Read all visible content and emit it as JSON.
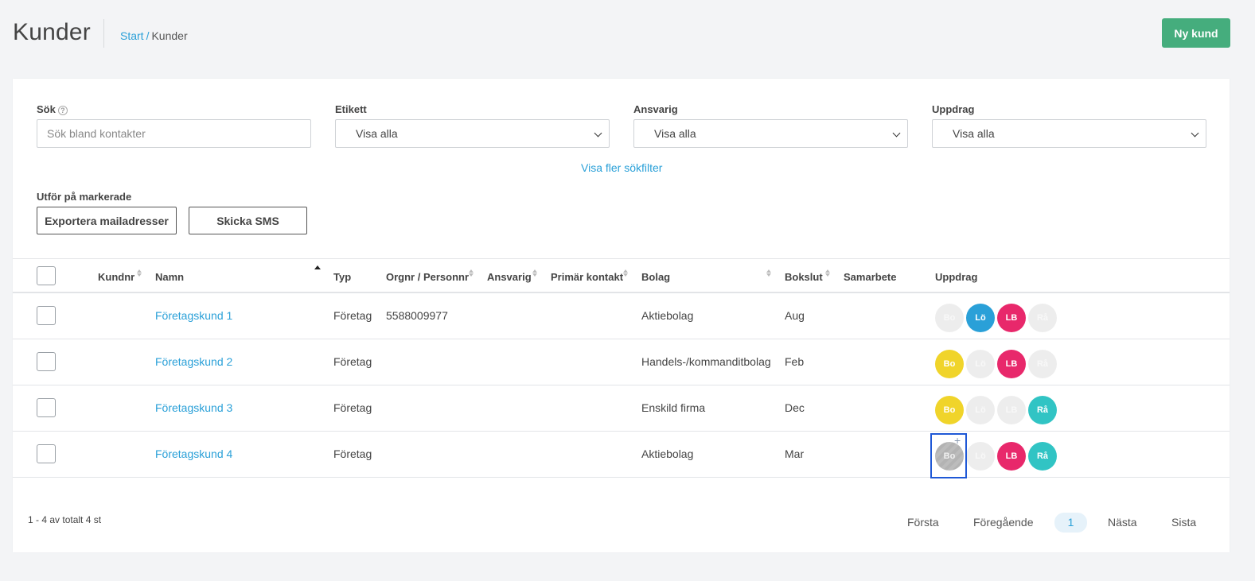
{
  "header": {
    "title": "Kunder",
    "breadcrumb": {
      "start": "Start",
      "separator": "/",
      "current": "Kunder"
    },
    "new_button": "Ny kund"
  },
  "filters": {
    "search": {
      "label": "Sök",
      "help": "?",
      "placeholder": "Sök bland kontakter",
      "value": ""
    },
    "etikett": {
      "label": "Etikett",
      "value": "Visa alla"
    },
    "ansvarig": {
      "label": "Ansvarig",
      "value": "Visa alla"
    },
    "uppdrag": {
      "label": "Uppdrag",
      "value": "Visa alla"
    },
    "more": "Visa fler sökfilter"
  },
  "bulk": {
    "label": "Utför på markerade",
    "export": "Exportera mailadresser",
    "sms": "Skicka SMS"
  },
  "table": {
    "columns": {
      "kundnr": "Kundnr",
      "namn": "Namn",
      "typ": "Typ",
      "orgnr": "Orgnr / Personnr",
      "ansvarig": "Ansvarig",
      "primar": "Primär kontakt",
      "bolag": "Bolag",
      "bokslut": "Bokslut",
      "samarbete": "Samarbete",
      "uppdrag": "Uppdrag"
    },
    "sorted_column": "Namn",
    "sort_direction": "ascending",
    "rows": [
      {
        "kundnr": "",
        "namn": "Företagskund 1",
        "typ": "Företag",
        "orgnr": "5588009977",
        "ansvarig": "",
        "primar": "",
        "bolag": "Aktiebolag",
        "bokslut": "Aug",
        "samarbete": "",
        "uppdrag": [
          {
            "label": "Bo",
            "state": "inactive"
          },
          {
            "label": "Lö",
            "state": "active"
          },
          {
            "label": "LB",
            "state": "active"
          },
          {
            "label": "Rå",
            "state": "inactive"
          }
        ]
      },
      {
        "kundnr": "",
        "namn": "Företagskund 2",
        "typ": "Företag",
        "orgnr": "",
        "ansvarig": "",
        "primar": "",
        "bolag": "Handels-/kommanditbolag",
        "bokslut": "Feb",
        "samarbete": "",
        "uppdrag": [
          {
            "label": "Bo",
            "state": "active"
          },
          {
            "label": "Lö",
            "state": "inactive"
          },
          {
            "label": "LB",
            "state": "active"
          },
          {
            "label": "Rå",
            "state": "inactive"
          }
        ]
      },
      {
        "kundnr": "",
        "namn": "Företagskund 3",
        "typ": "Företag",
        "orgnr": "",
        "ansvarig": "",
        "primar": "",
        "bolag": "Enskild firma",
        "bokslut": "Dec",
        "samarbete": "",
        "uppdrag": [
          {
            "label": "Bo",
            "state": "active"
          },
          {
            "label": "Lö",
            "state": "inactive"
          },
          {
            "label": "LB",
            "state": "inactive"
          },
          {
            "label": "Rå",
            "state": "active"
          }
        ]
      },
      {
        "kundnr": "",
        "namn": "Företagskund 4",
        "typ": "Företag",
        "orgnr": "",
        "ansvarig": "",
        "primar": "",
        "bolag": "Aktiebolag",
        "bokslut": "Mar",
        "samarbete": "",
        "uppdrag": [
          {
            "label": "Bo",
            "state": "disabled-hover"
          },
          {
            "label": "Lö",
            "state": "inactive"
          },
          {
            "label": "LB",
            "state": "active"
          },
          {
            "label": "Rå",
            "state": "active"
          }
        ]
      }
    ]
  },
  "uppdrag_colors": {
    "Bo": "#f0d42a",
    "Lö": "#2aa0d8",
    "LB": "#e8286b",
    "Rå": "#31c4c4",
    "inactive": "#ededed"
  },
  "footer": {
    "count": "1 - 4 av totalt 4 st",
    "first": "Första",
    "prev": "Föregående",
    "current_page": "1",
    "next": "Nästa",
    "last": "Sista"
  },
  "colors": {
    "accent": "#2aa0d8",
    "primary_button": "#45ad7d",
    "focus": "#1f58d6"
  },
  "icons": {
    "help": "question-circle-icon",
    "select_caret": "chevron-down-icon",
    "sort": "sort-arrows-icon",
    "cursor": "crosshair-plus-icon"
  }
}
